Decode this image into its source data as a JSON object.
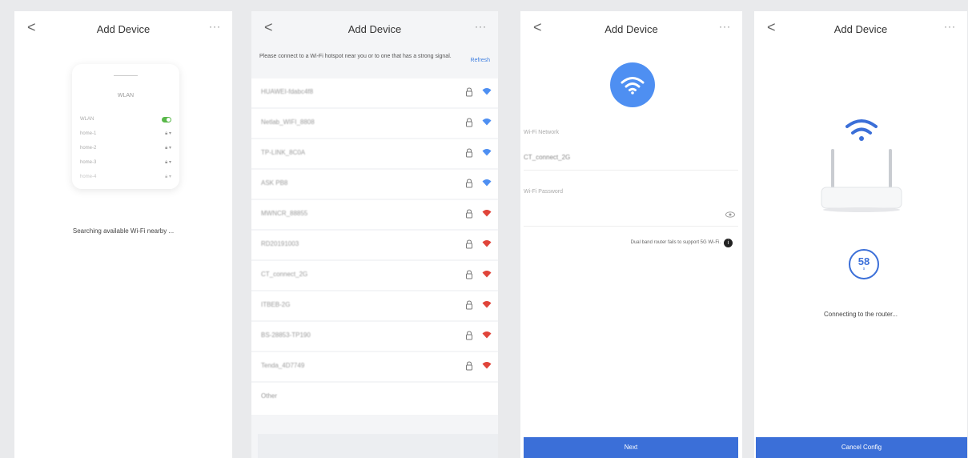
{
  "screen1": {
    "title": "Add Device",
    "back": "<",
    "more": "···",
    "phone": {
      "header": "WLAN",
      "toggle_label": "WLAN",
      "networks": [
        "home-1",
        "home-2",
        "home-3",
        "home-4"
      ]
    },
    "status": "Searching available Wi-Fi nearby ..."
  },
  "screen2": {
    "title": "Add Device",
    "back": "<",
    "more": "···",
    "hint": "Please connect to a Wi-Fi hotspot near you or to one that has a strong signal.",
    "refresh": "Refresh",
    "networks": [
      {
        "ssid": "HUAWEI-fdabc4f8",
        "signal": "strong"
      },
      {
        "ssid": "Netlab_WIFI_8808",
        "signal": "strong"
      },
      {
        "ssid": "TP-LINK_8C0A",
        "signal": "strong"
      },
      {
        "ssid": "ASK PB8",
        "signal": "strong"
      },
      {
        "ssid": "MWNCR_88855",
        "signal": "weak"
      },
      {
        "ssid": "RD20191003",
        "signal": "weak"
      },
      {
        "ssid": "CT_connect_2G",
        "signal": "weak"
      },
      {
        "ssid": "ITBEB-2G",
        "signal": "weak"
      },
      {
        "ssid": "BS-28853-TP190",
        "signal": "weak"
      },
      {
        "ssid": "Tenda_4D7749",
        "signal": "weak"
      }
    ],
    "other": "Other"
  },
  "screen3": {
    "title": "Add Device",
    "back": "<",
    "more": "···",
    "network_label": "Wi-Fi Network",
    "network_value": "CT_connect_2G",
    "password_label": "Wi-Fi Password",
    "dual_band_note": "Dual band router fails to support 5G Wi-Fi.",
    "info": "i",
    "next": "Next"
  },
  "screen4": {
    "title": "Add Device",
    "back": "<",
    "more": "···",
    "countdown": "58",
    "countdown_unit": "s",
    "status": "Connecting to the router...",
    "cancel": "Cancel Config"
  },
  "colors": {
    "accent": "#3b6fd8",
    "wifi_strong": "#4e8ff2",
    "wifi_weak": "#e0443a",
    "toggle_on": "#59b84a"
  },
  "icons": [
    "back-chevron-icon",
    "more-icon",
    "lock-icon",
    "wifi-signal-icon",
    "eye-icon",
    "info-icon",
    "router-icon"
  ]
}
